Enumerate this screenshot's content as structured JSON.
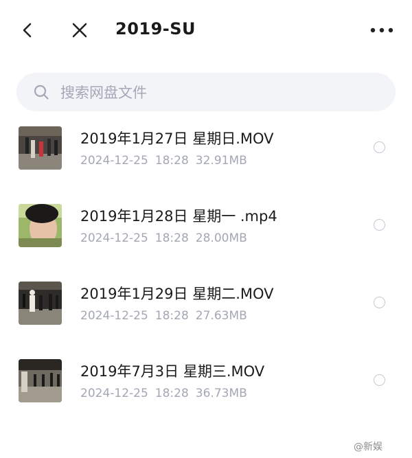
{
  "header": {
    "title": "2019-SU",
    "back_icon": "chevron-left-icon",
    "close_icon": "close-icon",
    "more_icon": "more-horizontal-icon"
  },
  "search": {
    "placeholder": "搜索网盘文件",
    "value": "",
    "icon": "search-icon"
  },
  "files": [
    {
      "name": "2019年1月27日 星期日.MOV",
      "date": "2024-12-25",
      "time": "18:28",
      "size": "32.91MB",
      "thumbnail": "video-thumbnail-dance-studio"
    },
    {
      "name": "2019年1月28日 星期一 .mp4",
      "date": "2024-12-25",
      "time": "18:28",
      "size": "28.00MB",
      "thumbnail": "video-thumbnail-selfie"
    },
    {
      "name": "2019年1月29日 星期二.MOV",
      "date": "2024-12-25",
      "time": "18:28",
      "size": "27.63MB",
      "thumbnail": "video-thumbnail-dance-studio"
    },
    {
      "name": "2019年7月3日 星期三.MOV",
      "date": "2024-12-25",
      "time": "18:28",
      "size": "36.73MB",
      "thumbnail": "video-thumbnail-dance-studio"
    }
  ],
  "watermark": "@新娱",
  "colors": {
    "search_bg": "#f3f4f8",
    "meta_text": "#a3a7b4",
    "radio_border": "#c6c8d0"
  }
}
